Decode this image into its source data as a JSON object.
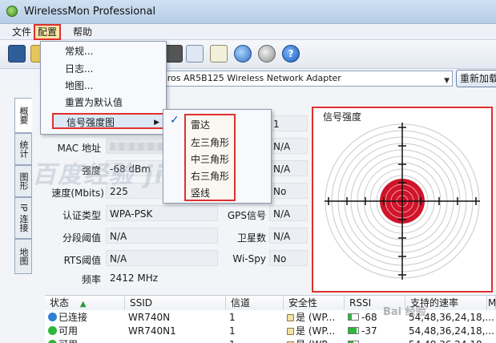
{
  "window": {
    "title": "WirelessMon Professional"
  },
  "menubar": {
    "file": "文件",
    "config": "配置",
    "help": "帮助"
  },
  "adapter": {
    "selected": "eros AR5B125 Wireless Network Adapter",
    "reload_label": "重新加载"
  },
  "config_menu": {
    "items": [
      "常规...",
      "日志...",
      "地图...",
      "重置为默认值",
      "信号强度图"
    ]
  },
  "signal_submenu": {
    "items": [
      "雷达",
      "左三角形",
      "中三角形",
      "右三角形",
      "竖线"
    ],
    "checked_index": 0
  },
  "side_tabs": [
    "概要",
    "统计",
    "图形",
    "IP 连接",
    "地图"
  ],
  "info": {
    "channel_value": "1",
    "mac_label": "MAC 地址",
    "mac_right_value": "N/A",
    "strength_label": "强度",
    "strength_value": "-68 dBm",
    "strength_right_value": "N/A",
    "speed_label": "速度(Mbits)",
    "speed_value": "225",
    "speed_right_value": "No",
    "auth_label": "认证类型",
    "auth_value": "WPA-PSK",
    "gps_label": "GPS信号",
    "gps_value": "N/A",
    "frag_label": "分段阈值",
    "frag_value": "N/A",
    "sat_label": "卫星数",
    "sat_value": "N/A",
    "rts_label": "RTS阈值",
    "rts_value": "N/A",
    "wispy_label": "Wi-Spy",
    "wispy_value": "No",
    "freq_label": "频率",
    "freq_value": "2412 MHz"
  },
  "signal_panel": {
    "title": "信号强度",
    "ring_count": 12,
    "colors": {
      "core": "#d0142a",
      "ring": "#c9c9c9",
      "axis": "#111111"
    }
  },
  "watermark": "百度经验 jingyan",
  "table": {
    "headers": [
      "状态",
      "SSID",
      "信道",
      "安全性",
      "RSSI",
      "支持的速率",
      "M"
    ],
    "rows": [
      {
        "status": "已连接",
        "status_color": "#2f7fd6",
        "ssid": "WR740N",
        "channel": "1",
        "security": "是 (WP...",
        "rssi": "-68",
        "rssi_level": 0.3,
        "rates": "54,48,36,24,18,..."
      },
      {
        "status": "可用",
        "status_color": "#2fb53a",
        "ssid": "WR740N1",
        "channel": "1",
        "security": "是 (WP...",
        "rssi": "-37",
        "rssi_level": 0.85,
        "rates": "54,48,36,24,18,..."
      },
      {
        "status": "可用",
        "status_color": "#2fb53a",
        "ssid": "",
        "channel": "1",
        "security": "是 (WP...",
        "rssi": "",
        "rssi_level": 0.5,
        "rates": "54,48,36,24,18,..."
      }
    ]
  },
  "baidu_mark": "Bai 经验"
}
